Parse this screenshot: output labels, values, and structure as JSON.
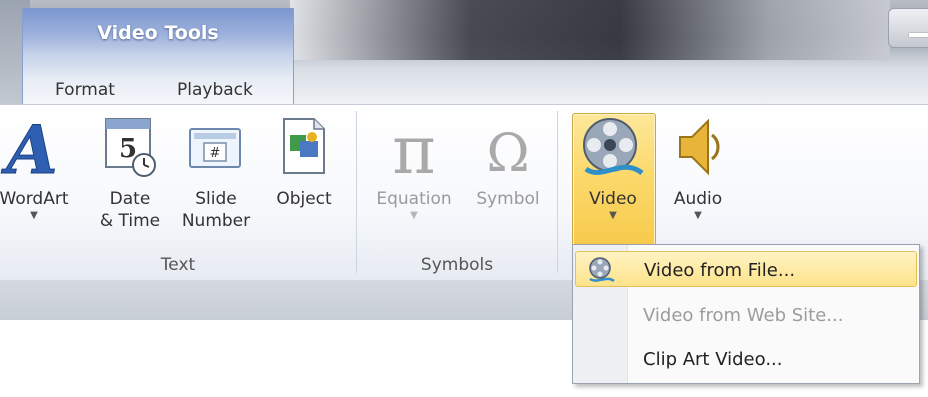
{
  "context_tab": {
    "group_title": "Video Tools",
    "tabs": [
      "Format",
      "Playback"
    ]
  },
  "ribbon": {
    "text_group": {
      "label": "Text",
      "commands": [
        {
          "label": "WordArt"
        },
        {
          "label": "Date\n& Time"
        },
        {
          "label": "Slide\nNumber"
        },
        {
          "label": "Object"
        }
      ]
    },
    "symbols_group": {
      "label": "Symbols",
      "commands": [
        {
          "label": "Equation"
        },
        {
          "label": "Symbol"
        }
      ]
    },
    "media_group": {
      "commands": [
        {
          "label": "Video"
        },
        {
          "label": "Audio"
        }
      ]
    }
  },
  "video_menu": {
    "items": [
      {
        "label": "Video from File...",
        "state": "highlighted"
      },
      {
        "label": "Video from Web Site...",
        "state": "disabled"
      },
      {
        "label": "Clip Art Video...",
        "state": "enabled"
      }
    ]
  },
  "colors": {
    "context_tab": "#9db1dc",
    "video_highlight": "#fbd96b",
    "menu_hover": "#fde38a",
    "wordart_blue": "#2f5fb3"
  }
}
